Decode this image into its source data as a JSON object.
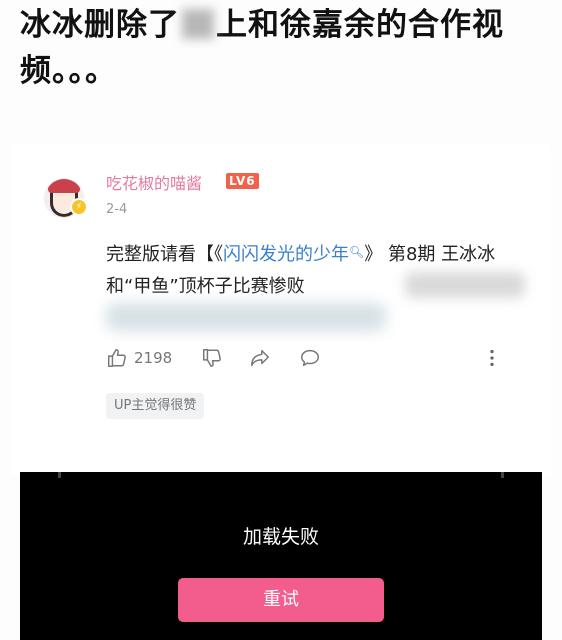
{
  "headline": {
    "part1": "冰冰删除了",
    "part2": "上和徐嘉余的合作视频。。。"
  },
  "comment": {
    "username": "吃花椒的喵酱",
    "level": "LV6",
    "date": "2-4",
    "text_before": "完整版请看【《",
    "link_text": "闪闪发光的少年",
    "text_after": "》 第8期 王冰冰和“甲鱼”顶杯子比赛惨败",
    "likes": "2198",
    "up_tag": "UP主觉得很赞"
  },
  "video": {
    "status": "加载失败",
    "retry_label": "重试",
    "background": "#000000"
  },
  "colors": {
    "username": "#e67a9d",
    "link": "#3a7fd0",
    "retry": "#f25d8e",
    "level_badge": "#f0634a"
  }
}
